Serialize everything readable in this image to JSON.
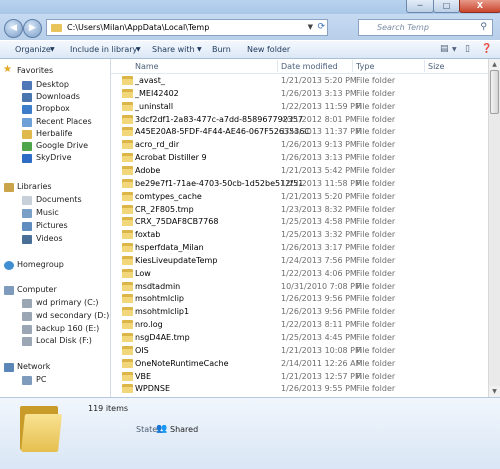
{
  "title_bar": {
    "min_label": "─",
    "max_label": "□",
    "close_label": "X"
  },
  "address": {
    "path": "C:\\Users\\Milan\\AppData\\Local\\Temp",
    "refresh_icon": "refresh-icon"
  },
  "search": {
    "placeholder": "Search Temp"
  },
  "toolbar": {
    "organize": "Organize",
    "include": "Include in library",
    "share": "Share with",
    "burn": "Burn",
    "new_folder": "New folder"
  },
  "nav": {
    "favorites_label": "Favorites",
    "favorites": [
      {
        "label": "Desktop",
        "color": "#4f78b8"
      },
      {
        "label": "Downloads",
        "color": "#4a76b0"
      },
      {
        "label": "Dropbox",
        "color": "#3c7cc9"
      },
      {
        "label": "Recent Places",
        "color": "#6ea0d8"
      },
      {
        "label": "Herbalife",
        "color": "#e0b94c"
      },
      {
        "label": "Google Drive",
        "color": "#4fa54a"
      },
      {
        "label": "SkyDrive",
        "color": "#2f6cc5"
      }
    ],
    "libraries_label": "Libraries",
    "libraries": [
      {
        "label": "Documents",
        "color": "#c7cfd9"
      },
      {
        "label": "Music",
        "color": "#7aa0c8"
      },
      {
        "label": "Pictures",
        "color": "#5f8dc0"
      },
      {
        "label": "Videos",
        "color": "#4a6f96"
      }
    ],
    "homegroup_label": "Homegroup",
    "computer_label": "Computer",
    "drives": [
      {
        "label": "wd primary (C:)"
      },
      {
        "label": "wd secondary (D:)"
      },
      {
        "label": "backup 160 (E:)"
      },
      {
        "label": "Local Disk (F:)"
      }
    ],
    "network_label": "Network",
    "network": [
      {
        "label": "PC"
      }
    ]
  },
  "columns": {
    "name": "Name",
    "date": "Date modified",
    "type": "Type",
    "size": "Size"
  },
  "files": [
    {
      "name": "_avast_",
      "date": "1/21/2013 5:20 PM",
      "type": "File folder"
    },
    {
      "name": "_MEI42402",
      "date": "1/26/2013 3:13 PM",
      "type": "File folder"
    },
    {
      "name": "_uninstall",
      "date": "1/22/2013 11:59 PM",
      "type": "File folder"
    },
    {
      "name": "3dcf2df1-2a83-477c-a7dd-858967792357",
      "date": "4/21/2012 8:01 PM",
      "type": "File folder"
    },
    {
      "name": "A45E20A8-5FDF-4F44-AE46-067F5263536C",
      "date": "1/24/2013 11:37 PM",
      "type": "File folder"
    },
    {
      "name": "acro_rd_dir",
      "date": "1/26/2013 9:13 PM",
      "type": "File folder"
    },
    {
      "name": "Acrobat Distiller 9",
      "date": "1/26/2013 3:13 PM",
      "type": "File folder"
    },
    {
      "name": "Adobe",
      "date": "1/21/2013 5:42 PM",
      "type": "File folder"
    },
    {
      "name": "be29e7f1-71ae-4703-50cb-1d52be512f51",
      "date": "1/22/2013 11:58 PM",
      "type": "File folder"
    },
    {
      "name": "comtypes_cache",
      "date": "1/21/2013 5:20 PM",
      "type": "File folder"
    },
    {
      "name": "CR_2F805.tmp",
      "date": "1/23/2013 8:32 PM",
      "type": "File folder"
    },
    {
      "name": "CRX_75DAF8CB7768",
      "date": "1/25/2013 4:58 PM",
      "type": "File folder"
    },
    {
      "name": "foxtab",
      "date": "1/25/2013 3:32 PM",
      "type": "File folder"
    },
    {
      "name": "hsperfdata_Milan",
      "date": "1/26/2013 3:17 PM",
      "type": "File folder"
    },
    {
      "name": "KiesLiveupdateTemp",
      "date": "1/24/2013 7:56 PM",
      "type": "File folder"
    },
    {
      "name": "Low",
      "date": "1/22/2013 4:06 PM",
      "type": "File folder"
    },
    {
      "name": "msdtadmin",
      "date": "10/31/2010 7:08 PM",
      "type": "File folder"
    },
    {
      "name": "msohtmlclip",
      "date": "1/26/2013 9:56 PM",
      "type": "File folder"
    },
    {
      "name": "msohtmlclip1",
      "date": "1/26/2013 9:56 PM",
      "type": "File folder"
    },
    {
      "name": "nro.log",
      "date": "1/22/2013 8:11 PM",
      "type": "File folder"
    },
    {
      "name": "nsgD4AE.tmp",
      "date": "1/25/2013 4:45 PM",
      "type": "File folder"
    },
    {
      "name": "OIS",
      "date": "1/21/2013 10:08 PM",
      "type": "File folder"
    },
    {
      "name": "OneNoteRuntimeCache",
      "date": "2/14/2011 12:26 AM",
      "type": "File folder"
    },
    {
      "name": "VBE",
      "date": "1/21/2013 12:57 PM",
      "type": "File folder"
    },
    {
      "name": "WPDNSE",
      "date": "1/26/2013 9:55 PM",
      "type": "File folder"
    }
  ],
  "details": {
    "count": "119 items",
    "state_label": "State:",
    "state_value": "Shared"
  },
  "colors": {
    "folder": "#f2d77a",
    "accent": "#1e395b"
  }
}
